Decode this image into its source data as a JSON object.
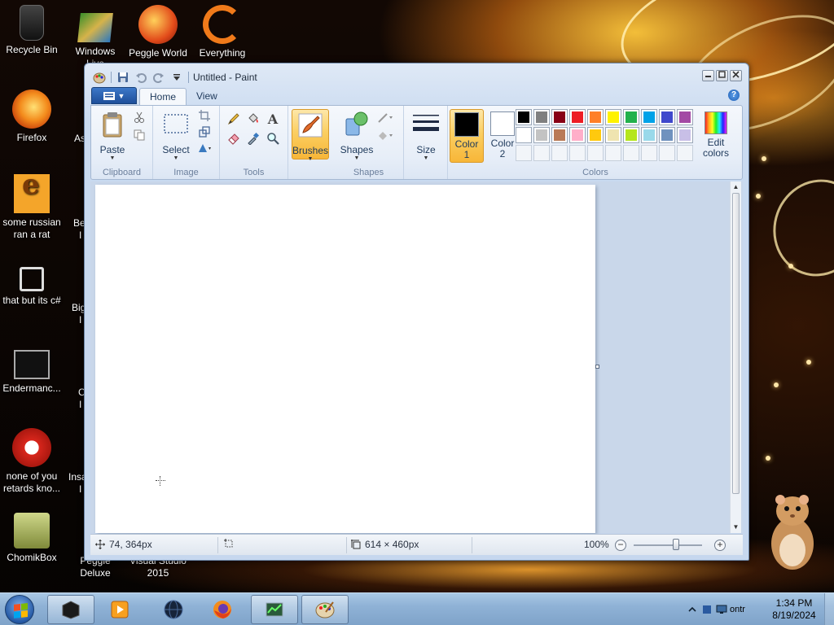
{
  "desktop": {
    "icons": [
      {
        "label": "Recycle Bin"
      },
      {
        "label": "Windows Live"
      },
      {
        "label": "Peggle World"
      },
      {
        "label": "Everything"
      },
      {
        "label": "Firefox"
      },
      {
        "label": "some russian ran a rat"
      },
      {
        "label": "that but its c#"
      },
      {
        "label": "Endermanc..."
      },
      {
        "label": "none of you retards kno..."
      },
      {
        "label": "ChomikBox"
      },
      {
        "label": "Peggle Deluxe"
      },
      {
        "label": "Visual Studio 2015"
      }
    ],
    "partial_labels": [
      "As",
      "Be",
      "I",
      "Big",
      "I",
      "C",
      "I",
      "Insa",
      "I"
    ]
  },
  "paint": {
    "title": "Untitled - Paint",
    "tabs": [
      {
        "label": "Home",
        "active": true
      },
      {
        "label": "View",
        "active": false
      }
    ],
    "help_glyph": "?",
    "groups": {
      "clipboard": {
        "label": "Clipboard",
        "paste": "Paste"
      },
      "image": {
        "label": "Image",
        "select": "Select"
      },
      "tools": {
        "label": "Tools",
        "text_glyph": "A"
      },
      "brushes": {
        "label": "Brushes"
      },
      "shapes": {
        "label": "Shapes",
        "button": "Shapes"
      },
      "size": {
        "label": "Size"
      },
      "colors": {
        "label": "Colors",
        "color1": "Color 1",
        "color1_line1": "Color",
        "color1_line2": "1",
        "color2_line1": "Color",
        "color2_line2": "2",
        "color1_value": "#000000",
        "color2_value": "#ffffff",
        "edit_line1": "Edit",
        "edit_line2": "colors",
        "palette": [
          "#000000",
          "#7f7f7f",
          "#880015",
          "#ed1c24",
          "#ff7f27",
          "#fff200",
          "#22b14c",
          "#00a2e8",
          "#3f48cc",
          "#a349a4",
          "#ffffff",
          "#c3c3c3",
          "#b97a57",
          "#ffaec9",
          "#ffc90e",
          "#efe4b0",
          "#b5e61d",
          "#99d9ea",
          "#7092be",
          "#c8bfe7",
          "",
          "",
          "",
          "",
          "",
          "",
          "",
          "",
          "",
          ""
        ]
      }
    },
    "status": {
      "cursor_pos": "74, 364px",
      "canvas_size": "614 × 460px",
      "zoom": "100%",
      "zoom_level_fraction": 0.5,
      "zoom_minus": "−",
      "zoom_plus": "+"
    }
  },
  "taskbar": {
    "clock_time": "1:34 PM",
    "clock_date": "8/19/2024",
    "tray_text": "ontr"
  },
  "colors": {
    "ribbon_accent": "#fbcf62",
    "taskbar": "#8fb2d6"
  }
}
